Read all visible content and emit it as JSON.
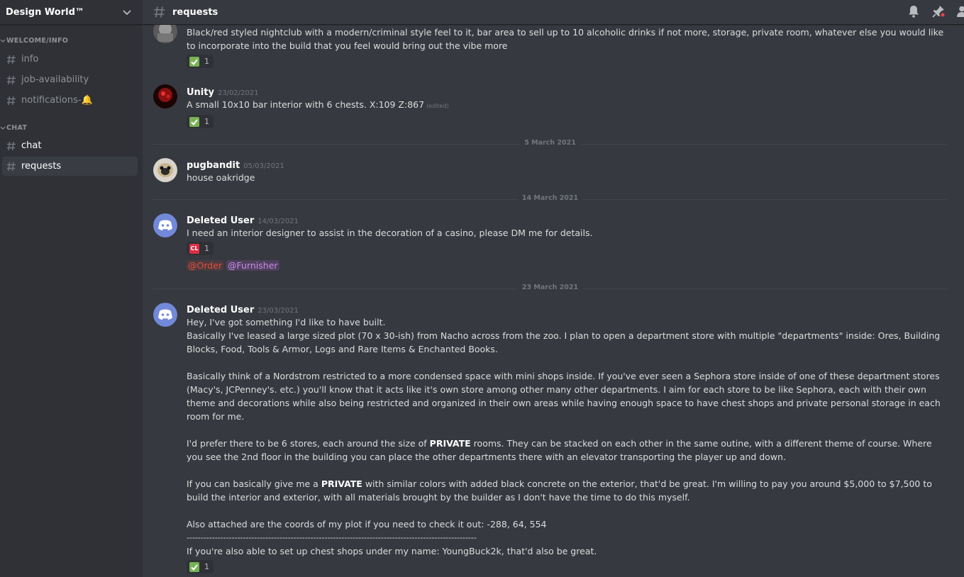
{
  "server": {
    "name": "Design World™"
  },
  "sidebar": {
    "categories": [
      {
        "label": "WELCOME/INFO"
      },
      {
        "label": "CHAT"
      }
    ],
    "channels": [
      {
        "label": "info"
      },
      {
        "label": "job-availability"
      },
      {
        "label": "notifications-🔔"
      },
      {
        "label": "chat"
      },
      {
        "label": "requests"
      }
    ]
  },
  "header": {
    "channel": "requests"
  },
  "messages": [
    {
      "text": "Black/red styled nightclub with a modern/criminal style feel to it, bar area to sell up to 10 alcoholic drinks if not more, storage, private room, whatever else you would like to incorporate into the build that you feel would bring out the vibe more",
      "reaction_count": "1"
    },
    {
      "author": "Unity",
      "timestamp": "23/02/2021",
      "text": "A small 10x10 bar interior with 6 chests. X:109 Z:867",
      "edited": "(edited)",
      "reaction_count": "1"
    },
    {
      "author": "pugbandit",
      "timestamp": "05/03/2021",
      "text": "house oakridge"
    },
    {
      "author": "Deleted User",
      "timestamp": "14/03/2021",
      "text": "I need an interior designer to assist in the decoration of a casino, please DM me for details.",
      "reaction_count": "1",
      "reaction_emoji": "CL",
      "mention_1": "@Order",
      "mention_2": "@Furnisher"
    },
    {
      "author": "Deleted User",
      "timestamp": "23/03/2021",
      "line1": "Hey, I've got something I'd like to have built.",
      "para1": "Basically I've leased a large sized plot  (70 x 30-ish) from Nacho across from the zoo. I plan to open a department store with multiple \"departments\" inside: Ores, Building Blocks, Food, Tools & Armor, Logs and Rare Items & Enchanted Books.",
      "para2": "Basically think of a Nordstrom restricted to a more condensed space with mini shops inside. If you've ever seen a Sephora store inside of one of these department stores (Macy's, JCPenney's. etc.) you'll know that it acts like it's own store among other many other departments. I aim for each store to be like Sephora, each with their own theme and decorations while also being restricted and organized in their own areas while having enough space to have chest shops and private personal storage in each room for me.",
      "para3_a": "I'd prefer there to be 6 stores, each around the size of ",
      "para3_bold": "PRIVATE",
      "para3_b": " rooms. They can be stacked on each other in the same outine, with a different theme of course. Where you see the 2nd floor in the building you can place the other departments there with an elevator transporting the player up and down.",
      "para4_a": "If you can basically give me a ",
      "para4_bold": "PRIVATE",
      "para4_b": " with similar colors with added black concrete on the exterior, that'd be great. I'm willing to pay you around $5,000 to $7,500 to build the interior and exterior, with all materials brought by the builder as I don't have the time to do this myself.",
      "para5": "Also attached are the coords of my plot if you need to check it out: -288, 64, 554",
      "dashes": "-------------------------------------------------------------------------------------------------------",
      "para6": "If you're also able to set up chest shops under my name: YoungBuck2k, that'd also be great.",
      "reaction_count": "1"
    }
  ],
  "dividers": [
    "5 March 2021",
    "14 March 2021",
    "23 March 2021"
  ],
  "colors": {
    "bg": "#36393f",
    "sidebar": "#2f3136",
    "blurple": "#7289da",
    "check": "#77b255"
  },
  "icons": [
    "chevron-down-icon",
    "hash-icon",
    "bell-icon",
    "pin-icon",
    "members-icon",
    "check-emoji-icon"
  ]
}
